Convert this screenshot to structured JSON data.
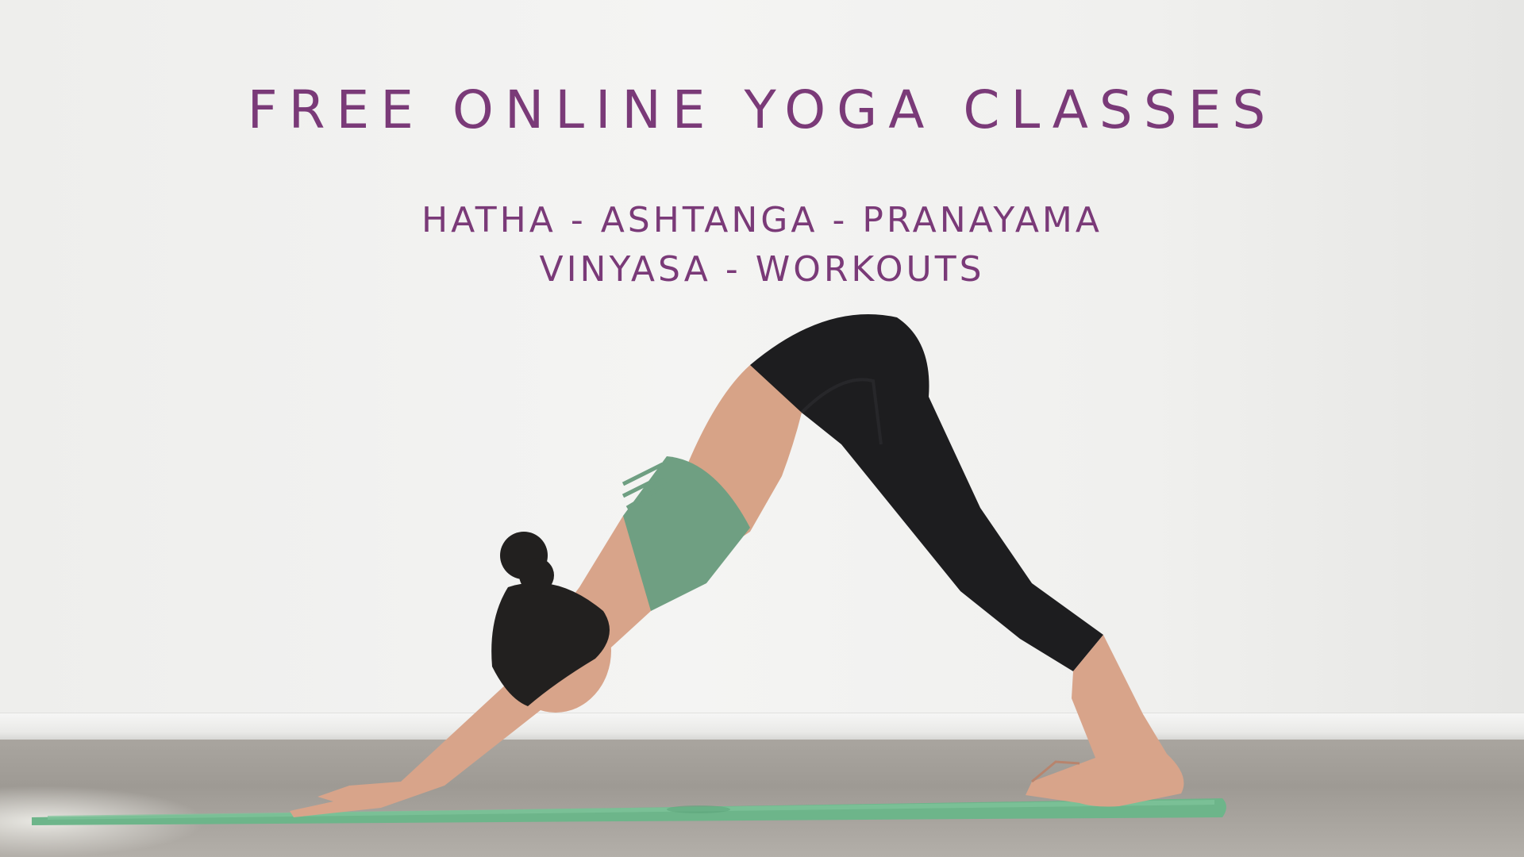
{
  "banner": {
    "headline": "FREE ONLINE YOGA CLASSES",
    "styles_line_1": "HATHA - ASHTANGA - PRANAYAMA",
    "styles_line_2": "VINYASA - WORKOUTS"
  },
  "colors": {
    "text": "#7a3a78",
    "top": "#6f9f82",
    "leggings": "#1d1d1f",
    "mat": "#6db58a",
    "skin": "#d8a48a"
  }
}
